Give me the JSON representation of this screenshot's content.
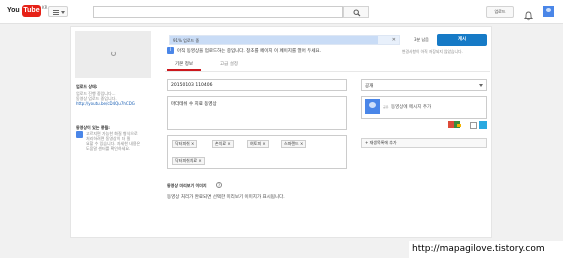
{
  "header": {
    "logo_you": "You",
    "logo_tube": "Tube",
    "logo_region": "KR",
    "upload_label": "업로드"
  },
  "upload": {
    "progress_text": "91% 업로드 중",
    "progress_fraction": 0.91,
    "time_left": "3분 남음",
    "publish_label": "게시",
    "notice": "아직 동영상을 업로드하는 중입니다. 창초를 페이지 이 페이지를 열어 두세요.",
    "side_note": "변경사항이 아직 저장되지 않았습니다."
  },
  "left": {
    "status_title": "업로드 상태:",
    "status_lines": [
      "업로드 진행 중입니다...",
      "동영상 업로드 중입니다.",
      "http://youtu.be/cD4Qu7hCDG"
    ],
    "featured_title": "동영상이 있는 풍월:",
    "featured_lines": [
      "고르지면 가능한 화질 형식으로",
      "처리하려면 동영상이 더 필",
      "요할 수 있습니다. 자세한 내용은",
      "도움말 센터를 확인하세요."
    ]
  },
  "tabs": {
    "basic": "기본 정보",
    "advanced": "고급 설정"
  },
  "form": {
    "title_value": "20150103 110406",
    "description_value": "마더테쉬 수 치료 동영상",
    "tags": [
      "닥터피쉬",
      "손치료",
      "여토피",
      "스파랜드",
      "닥터피쉬치료"
    ],
    "privacy_value": "공개",
    "share_prefix": "공유",
    "share_placeholder": "동영상에 메시지 추가",
    "add_playlist": "+ 재생목록에 추가",
    "thumb_label": "동영상 미리보기 이미지",
    "thumb_help": "?",
    "thumb_note": "동영상 처리가 완료되면 선택한 미리보기 이미지가 표시됩니다.",
    "notice_icon": "i"
  },
  "icons": {
    "search": "search-icon",
    "bell": "bell-icon",
    "twitter": "twitter-icon",
    "gplus": "google-plus-icon"
  },
  "colors": {
    "accent": "#167ac6",
    "logo_red": "#e62117",
    "tab_underline": "#cc181e"
  },
  "watermark": "http://mapagilove.tistory.com"
}
